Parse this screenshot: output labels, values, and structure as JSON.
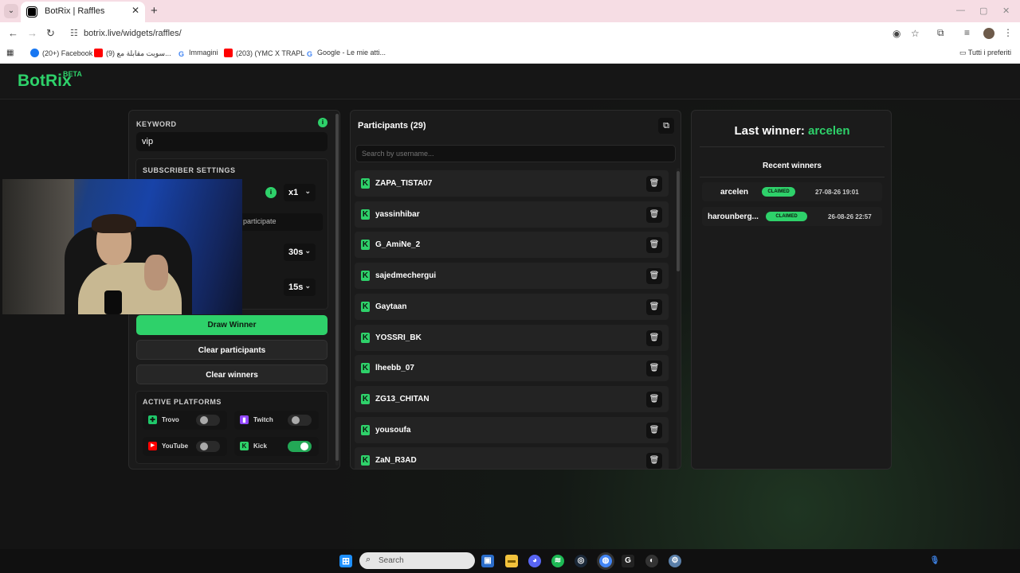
{
  "browser": {
    "tab_title": "BotRix | Raffles",
    "tab_close": "✕",
    "new_tab": "+",
    "url": "botrix.live/widgets/raffles/",
    "bookmarks": [
      {
        "label": "(20+) Facebook",
        "color": "#1877f2"
      },
      {
        "label": "(9) سويت مقابلة مع...",
        "color": "#ff0000"
      },
      {
        "label": "Immagini",
        "color": "#4285f4"
      },
      {
        "label": "(203) (YMC X TRAPL...",
        "color": "#ff0000"
      },
      {
        "label": "Google - Le mie atti...",
        "color": "#4285f4"
      }
    ],
    "all_bookmarks": "Tutti i preferiti"
  },
  "app": {
    "logo": "BotRix",
    "logo_badge": "BETA"
  },
  "settings": {
    "keyword_label": "KEYWORD",
    "keyword_value": "vip",
    "subscriber_label": "SUBSCRIBER SETTINGS",
    "multiplier": "x1",
    "participate_hint": "participate",
    "timer_1": "30s",
    "timer_2": "15s",
    "draw_winner": "Draw Winner",
    "clear_participants": "Clear participants",
    "clear_winners": "Clear winners",
    "platforms_label": "ACTIVE PLATFORMS",
    "platforms": [
      {
        "name": "Trovo",
        "enabled": false,
        "color": "#1fc76a"
      },
      {
        "name": "Twitch",
        "enabled": false,
        "color": "#9146ff"
      },
      {
        "name": "YouTube",
        "enabled": false,
        "color": "#ff0000"
      },
      {
        "name": "Kick",
        "enabled": true,
        "color": "#2ed16a"
      }
    ]
  },
  "participants": {
    "title": "Participants (29)",
    "search_placeholder": "Search by username...",
    "items": [
      "ZAPA_TISTA07",
      "yassinhibar",
      "G_AmiNe_2",
      "sajedmechergui",
      "Gaytaan",
      "YOSSRI_BK",
      "lheebb_07",
      "ZG13_CHITAN",
      "yousoufa",
      "ZaN_R3AD"
    ]
  },
  "winners": {
    "last_winner_label": "Last winner: ",
    "last_winner_name": "arcelen",
    "recent_label": "Recent winners",
    "recent": [
      {
        "name": "arcelen",
        "status": "CLAIMED",
        "date": "27-08-26 19:01"
      },
      {
        "name": "harounberg...",
        "status": "CLAIMED",
        "date": "26-08-26 22:57"
      }
    ]
  },
  "taskbar": {
    "search_placeholder": "Search"
  },
  "colors": {
    "accent": "#2ed16a",
    "background": "#141414",
    "panel": "#1b1b1b"
  }
}
